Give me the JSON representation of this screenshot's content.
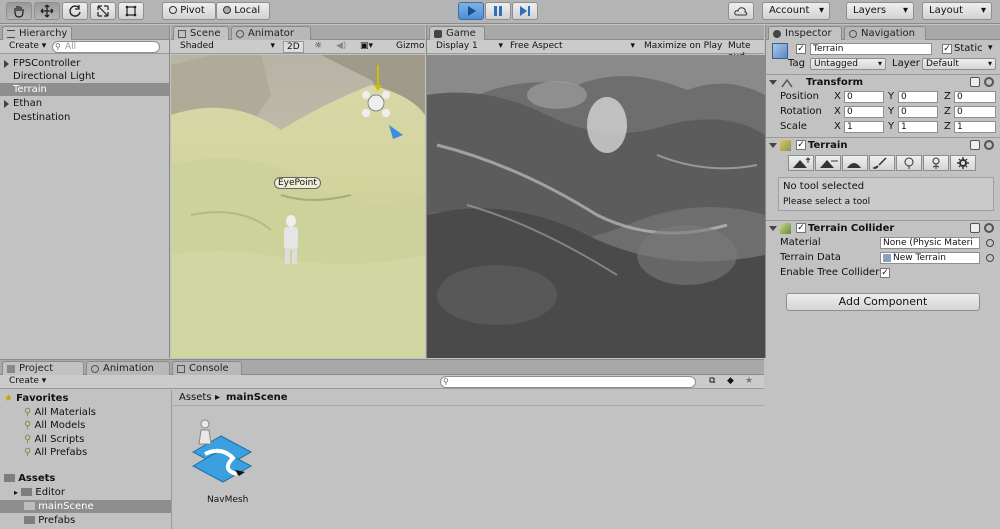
{
  "toolbar": {
    "pivot": "Pivot",
    "local": "Local",
    "account": "Account",
    "layers": "Layers",
    "layout": "Layout"
  },
  "hierarchy": {
    "tab": "Hierarchy",
    "create": "Create",
    "search_placeholder": "All",
    "items": [
      {
        "label": "FPSController",
        "expandable": true
      },
      {
        "label": "Directional Light",
        "expandable": false
      },
      {
        "label": "Terrain",
        "expandable": false,
        "selected": true
      },
      {
        "label": "Ethan",
        "expandable": true
      },
      {
        "label": "Destination",
        "expandable": false
      }
    ]
  },
  "scene": {
    "tab": "Scene",
    "animator_tab": "Animator",
    "shading": "Shaded",
    "mode_2d": "2D",
    "gizmos": "Gizmo",
    "label_eyepoint": "EyePoint"
  },
  "game": {
    "tab": "Game",
    "display": "Display 1",
    "aspect": "Free Aspect",
    "maximize": "Maximize on Play",
    "mute": "Mute aud"
  },
  "inspector": {
    "tab": "Inspector",
    "navigation_tab": "Navigation",
    "object_name": "Terrain",
    "static_label": "Static",
    "tag_label": "Tag",
    "tag_value": "Untagged",
    "layer_label": "Layer",
    "layer_value": "Default",
    "transform": {
      "title": "Transform",
      "rows": [
        {
          "label": "Position",
          "x": "0",
          "y": "0",
          "z": "0"
        },
        {
          "label": "Rotation",
          "x": "0",
          "y": "0",
          "z": "0"
        },
        {
          "label": "Scale",
          "x": "1",
          "y": "1",
          "z": "1"
        }
      ],
      "axis_x": "X",
      "axis_y": "Y",
      "axis_z": "Z"
    },
    "terrain": {
      "title": "Terrain",
      "no_tool": "No tool selected",
      "select_tool": "Please select a tool"
    },
    "collider": {
      "title": "Terrain Collider",
      "material_label": "Material",
      "material_value": "None (Physic Materi",
      "data_label": "Terrain Data",
      "data_value": "New Terrain",
      "tree_label": "Enable Tree Collider"
    },
    "add_component": "Add Component"
  },
  "project": {
    "tab": "Project",
    "animation_tab": "Animation",
    "console_tab": "Console",
    "create": "Create",
    "favorites": "Favorites",
    "favorite_items": [
      "All Materials",
      "All Models",
      "All Scripts",
      "All Prefabs"
    ],
    "assets": "Assets",
    "asset_folders": [
      {
        "label": "Editor",
        "selected": false
      },
      {
        "label": "mainScene",
        "selected": true
      },
      {
        "label": "Prefabs",
        "selected": false
      }
    ],
    "breadcrumb_root": "Assets",
    "breadcrumb_current": "mainScene",
    "asset_item": "NavMesh"
  },
  "colors": {
    "play_blue": "#4c8fd6",
    "selection": "#8e8e8e",
    "navmesh_blue": "#3aa0e0"
  }
}
